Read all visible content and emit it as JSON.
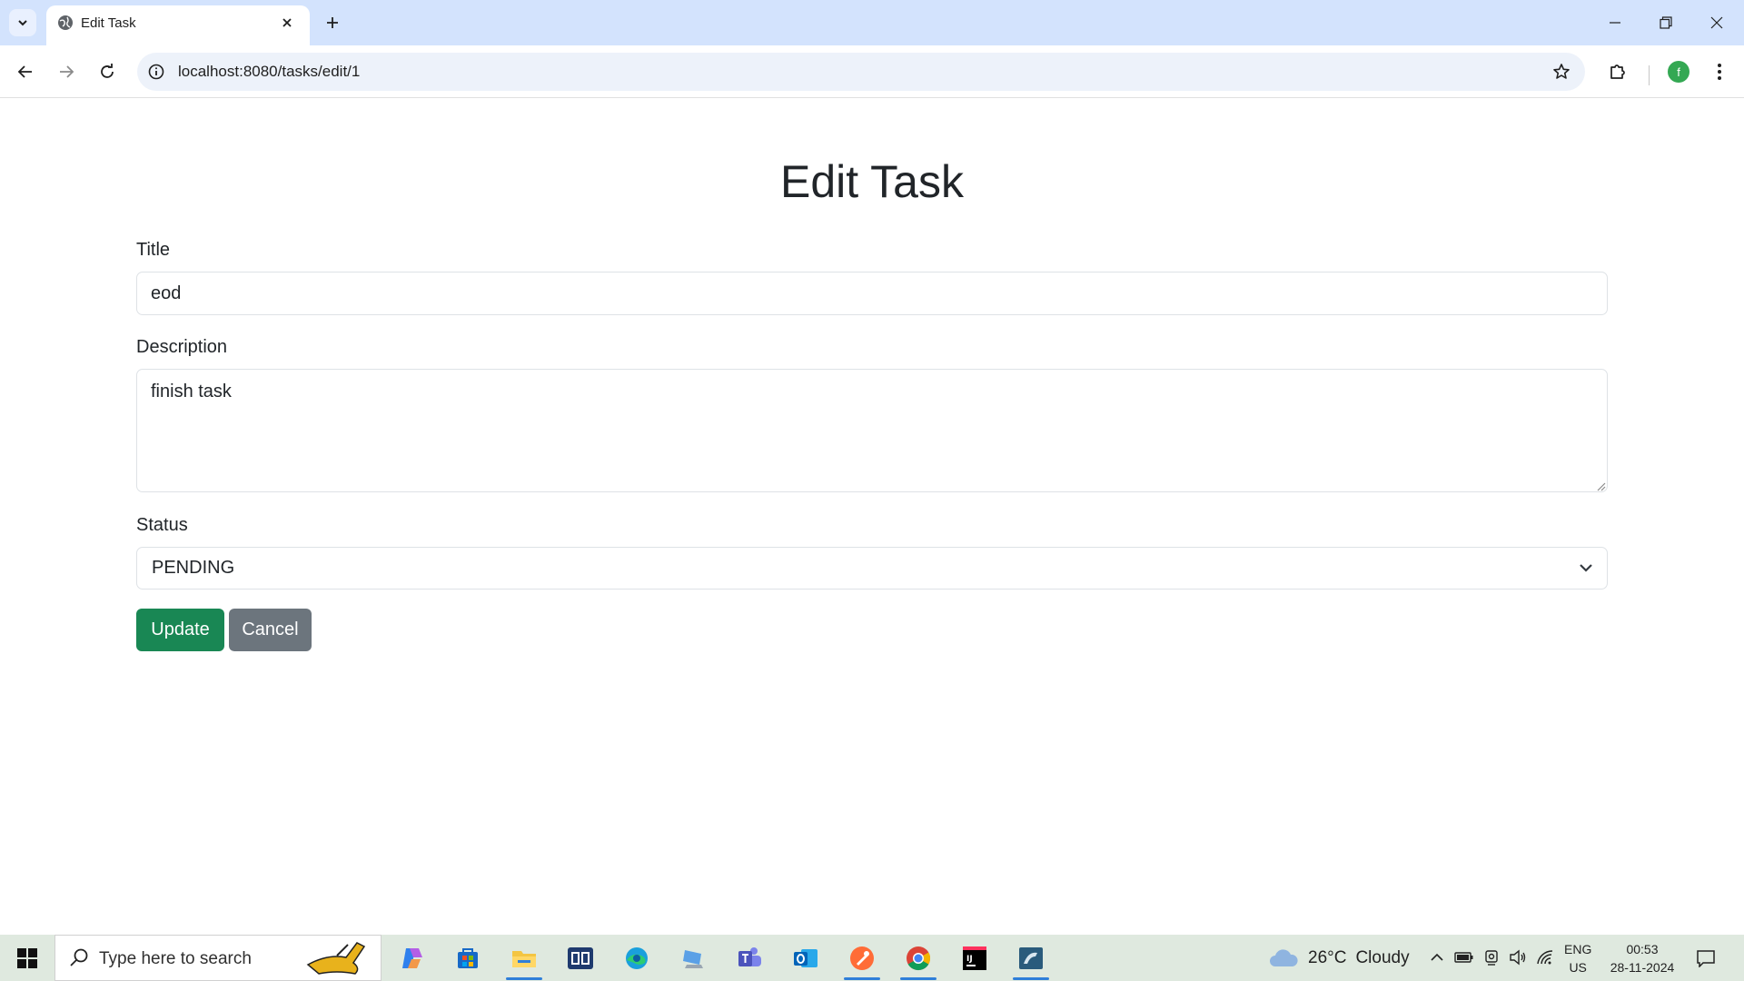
{
  "browser": {
    "tab_title": "Edit Task",
    "url": "localhost:8080/tasks/edit/1",
    "profile_initial": "f"
  },
  "page": {
    "heading": "Edit Task",
    "form": {
      "title_label": "Title",
      "title_value": "eod",
      "description_label": "Description",
      "description_value": "finish task",
      "status_label": "Status",
      "status_value": "PENDING",
      "update_label": "Update",
      "cancel_label": "Cancel"
    }
  },
  "colors": {
    "update_button": "#198754",
    "cancel_button": "#6c757d",
    "tabstrip": "#d3e3fd"
  },
  "taskbar": {
    "search_placeholder": "Type here to search",
    "weather_temp": "26°C",
    "weather_text": "Cloudy",
    "lang_line1": "ENG",
    "lang_line2": "US",
    "time": "00:53",
    "date": "28-11-2024",
    "apps": [
      "copilot-icon",
      "store-icon",
      "file-explorer-icon",
      "dell-icon",
      "edge-icon",
      "remote-desktop-icon",
      "teams-icon",
      "outlook-icon",
      "postman-icon",
      "chrome-icon",
      "intellij-icon",
      "mysql-workbench-icon"
    ]
  }
}
